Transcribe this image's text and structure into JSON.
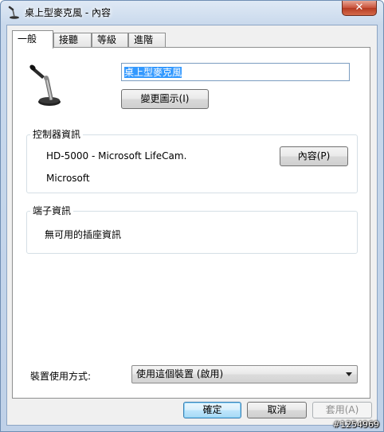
{
  "window": {
    "title": "桌上型麥克風 - 內容",
    "close_label": "✕"
  },
  "tabs": [
    {
      "label": "一般",
      "active": true
    },
    {
      "label": "接聽",
      "active": false
    },
    {
      "label": "等級",
      "active": false
    },
    {
      "label": "進階",
      "active": false
    }
  ],
  "general": {
    "device_name_value": "桌上型麥克風",
    "change_icon_label": "變更圖示(I)",
    "controller": {
      "title": "控制器資訊",
      "device_model": "HD-5000 - Microsoft LifeCam.",
      "manufacturer": "Microsoft",
      "properties_label": "內容(P)"
    },
    "jack": {
      "title": "端子資訊",
      "info": "無可用的插座資訊"
    },
    "usage": {
      "label": "裝置使用方式:",
      "selected": "使用這個裝置 (啟用)"
    }
  },
  "footer": {
    "ok_label": "確定",
    "cancel_label": "取消",
    "apply_label": "套用(A)"
  },
  "watermark": "#1254969",
  "icons": {
    "app": "microphone-icon",
    "device": "microphone-icon",
    "close": "close-icon",
    "dropdown": "chevron-down-icon"
  },
  "colors": {
    "selection": "#3399ff",
    "close_button": "#c8513a",
    "default_button_border": "#3c7fb1"
  }
}
